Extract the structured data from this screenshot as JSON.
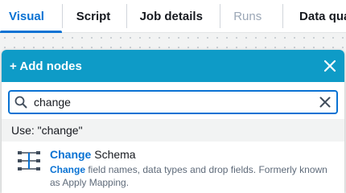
{
  "tabs": [
    {
      "label": "Visual",
      "state": "active"
    },
    {
      "label": "Script",
      "state": "normal"
    },
    {
      "label": "Job details",
      "state": "normal"
    },
    {
      "label": "Runs",
      "state": "disabled"
    },
    {
      "label": "Data quali",
      "state": "normal"
    }
  ],
  "panel": {
    "title": "+ Add nodes",
    "close_icon": "close-icon"
  },
  "search": {
    "value": "change",
    "placeholder": "",
    "icon": "search-icon",
    "clear_icon": "clear-icon"
  },
  "use_suggestion": "Use: \"change\"",
  "results": [
    {
      "icon": "change-schema-icon",
      "title_highlight": "Change",
      "title_rest": " Schema",
      "desc_highlight": "Change",
      "desc_rest": " field names, data types and drop fields. Formerly known as Apply Mapping."
    }
  ],
  "colors": {
    "accent": "#0972d3",
    "header": "#0e9bc7",
    "disabled": "#9ba7b6"
  }
}
